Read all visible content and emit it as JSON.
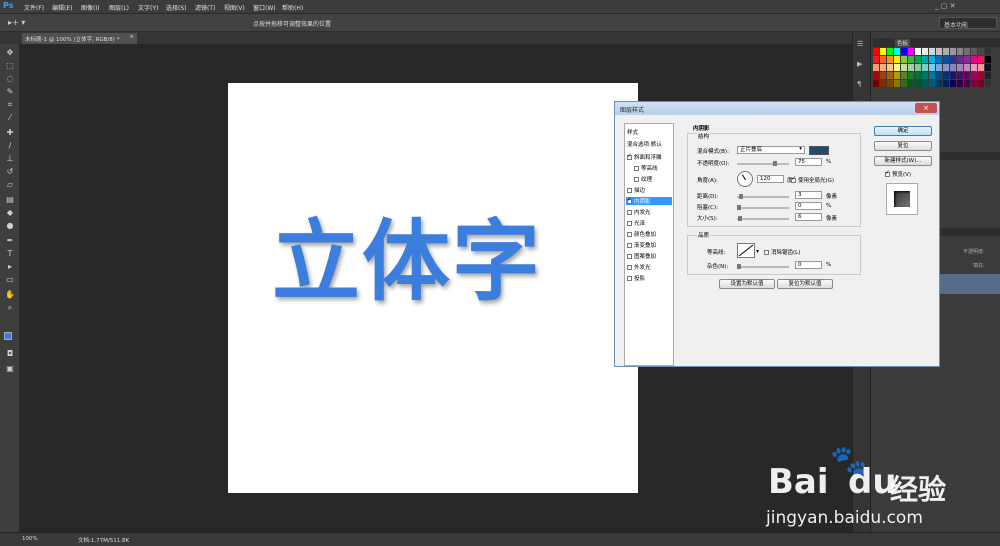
{
  "app": {
    "logo": "Ps"
  },
  "menu": [
    "文件(F)",
    "编辑(E)",
    "图像(I)",
    "图层(L)",
    "文字(Y)",
    "选择(S)",
    "滤镜(T)",
    "视图(V)",
    "窗口(W)",
    "帮助(H)"
  ],
  "options_bar": {
    "hint": "点按并拖移可调整效果的位置",
    "workspace": "基本功能"
  },
  "document": {
    "tab_label": "未标题-1 @ 100% (立体字, RGB/8) *",
    "close": "×",
    "canvas_text": "立体字"
  },
  "status": {
    "zoom": "100%",
    "doc_info": "文档:1.77M/511.8K"
  },
  "right_panel": {
    "color_tab": "色板",
    "opacity_label": "不透明度:",
    "fill_label": "填充:"
  },
  "dialog": {
    "title": "图层样式",
    "close": "×",
    "styles_header": "样式",
    "blend_default": "混合选项:默认",
    "items": [
      {
        "label": "斜面和浮雕",
        "checked": true,
        "indent": false
      },
      {
        "label": "等高线",
        "checked": false,
        "indent": true
      },
      {
        "label": "纹理",
        "checked": false,
        "indent": true
      },
      {
        "label": "描边",
        "checked": false,
        "indent": false
      },
      {
        "label": "内阴影",
        "checked": true,
        "indent": false,
        "active": true
      },
      {
        "label": "内发光",
        "checked": false,
        "indent": false
      },
      {
        "label": "光泽",
        "checked": false,
        "indent": false
      },
      {
        "label": "颜色叠加",
        "checked": false,
        "indent": false
      },
      {
        "label": "渐变叠加",
        "checked": false,
        "indent": false
      },
      {
        "label": "图案叠加",
        "checked": false,
        "indent": false
      },
      {
        "label": "外发光",
        "checked": false,
        "indent": false
      },
      {
        "label": "投影",
        "checked": false,
        "indent": false
      }
    ],
    "section_title": "内阴影",
    "structure_title": "结构",
    "blend_mode_label": "混合模式(B):",
    "blend_mode_value": "正片叠底",
    "shadow_color": "#1f4a72",
    "opacity_label": "不透明度(O):",
    "opacity_value": "75",
    "opacity_level": 0.75,
    "angle_label": "角度(A):",
    "angle_value": "120",
    "angle_unit": "度",
    "global_light_label": "使用全局光(G)",
    "distance_label": "距离(D):",
    "distance_value": "3",
    "choke_label": "阻塞(C):",
    "choke_value": "0",
    "size_label": "大小(S):",
    "size_value": "6",
    "px_unit": "像素",
    "pct_unit": "%",
    "quality_title": "品质",
    "contour_label": "等高线:",
    "antialias_label": "消除锯齿(L)",
    "noise_label": "杂色(N):",
    "noise_value": "0",
    "default_btn": "设置为默认值",
    "reset_btn": "复位为默认值",
    "ok_btn": "确定",
    "cancel_btn": "复位",
    "new_style_btn": "新建样式(W)...",
    "preview_label": "预览(V)"
  },
  "watermark": {
    "brand": "Bai",
    "brand2": "du",
    "cn": "经验",
    "url": "jingyan.baidu.com"
  },
  "colors": {
    "accent": "#3c7ede",
    "ps_blue": "#38a0f0"
  }
}
